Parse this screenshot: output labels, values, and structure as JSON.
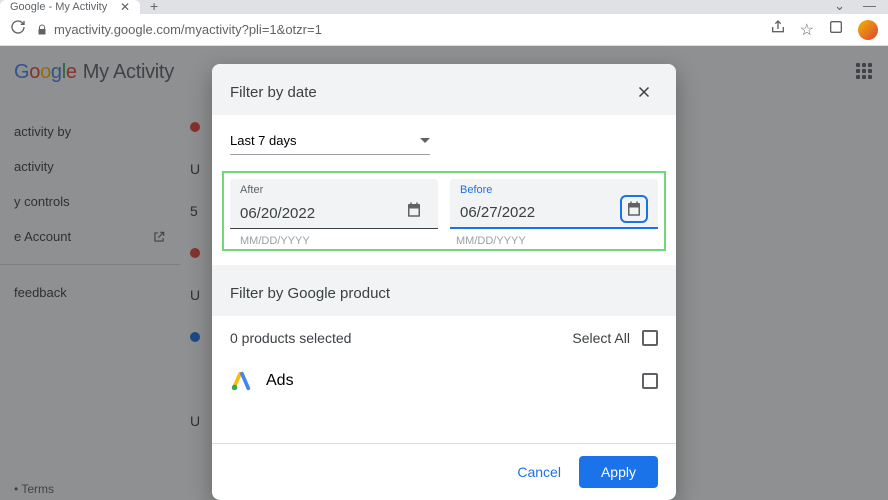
{
  "browser": {
    "tab_title": "Google - My Activity",
    "url": "myactivity.google.com/myactivity?pli=1&otzr=1"
  },
  "header": {
    "logo_plain": "Google",
    "logo_suffix": "My Activity"
  },
  "sidebar": {
    "items": [
      {
        "label": "activity by"
      },
      {
        "label": "activity"
      },
      {
        "label": "y controls"
      },
      {
        "label": "e Account",
        "external": true
      }
    ],
    "feedback": "feedback"
  },
  "footer": {
    "terms": "Terms"
  },
  "background_rows": [
    {
      "letter": "U"
    },
    {
      "letter": "5"
    },
    {
      "letter": "U"
    },
    {
      "letter": ""
    },
    {
      "letter": ""
    },
    {
      "letter": ""
    },
    {
      "letter": "U"
    }
  ],
  "modal": {
    "filter_by_date": "Filter by date",
    "range_label": "Last 7 days",
    "after_label": "After",
    "after_value": "06/20/2022",
    "before_label": "Before",
    "before_value": "06/27/2022",
    "hint": "MM/DD/YYYY",
    "filter_by_product": "Filter by Google product",
    "products_selected": "0 products selected",
    "select_all": "Select All",
    "product_ads": "Ads",
    "cancel": "Cancel",
    "apply": "Apply"
  }
}
